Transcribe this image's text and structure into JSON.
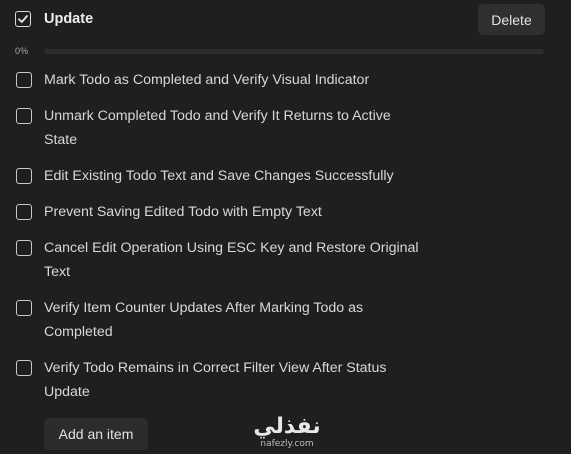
{
  "header": {
    "checked": true,
    "title": "Update",
    "delete_label": "Delete"
  },
  "progress": {
    "label": "0%",
    "value": 0
  },
  "items": [
    {
      "text": "Mark Todo as Completed and Verify Visual Indicator",
      "checked": false
    },
    {
      "text": "Unmark Completed Todo and Verify It Returns to Active State",
      "checked": false
    },
    {
      "text": "Edit Existing Todo Text and Save Changes Successfully",
      "checked": false
    },
    {
      "text": "Prevent Saving Edited Todo with Empty Text",
      "checked": false
    },
    {
      "text": "Cancel Edit Operation Using ESC Key and Restore Original Text",
      "checked": false
    },
    {
      "text": "Verify Item Counter Updates After Marking Todo as Completed",
      "checked": false
    },
    {
      "text": "Verify Todo Remains in Correct Filter View After Status Update",
      "checked": false
    }
  ],
  "add_item_label": "Add an item",
  "watermark": {
    "arabic": "نفذلي",
    "latin": "nafezly.com"
  }
}
